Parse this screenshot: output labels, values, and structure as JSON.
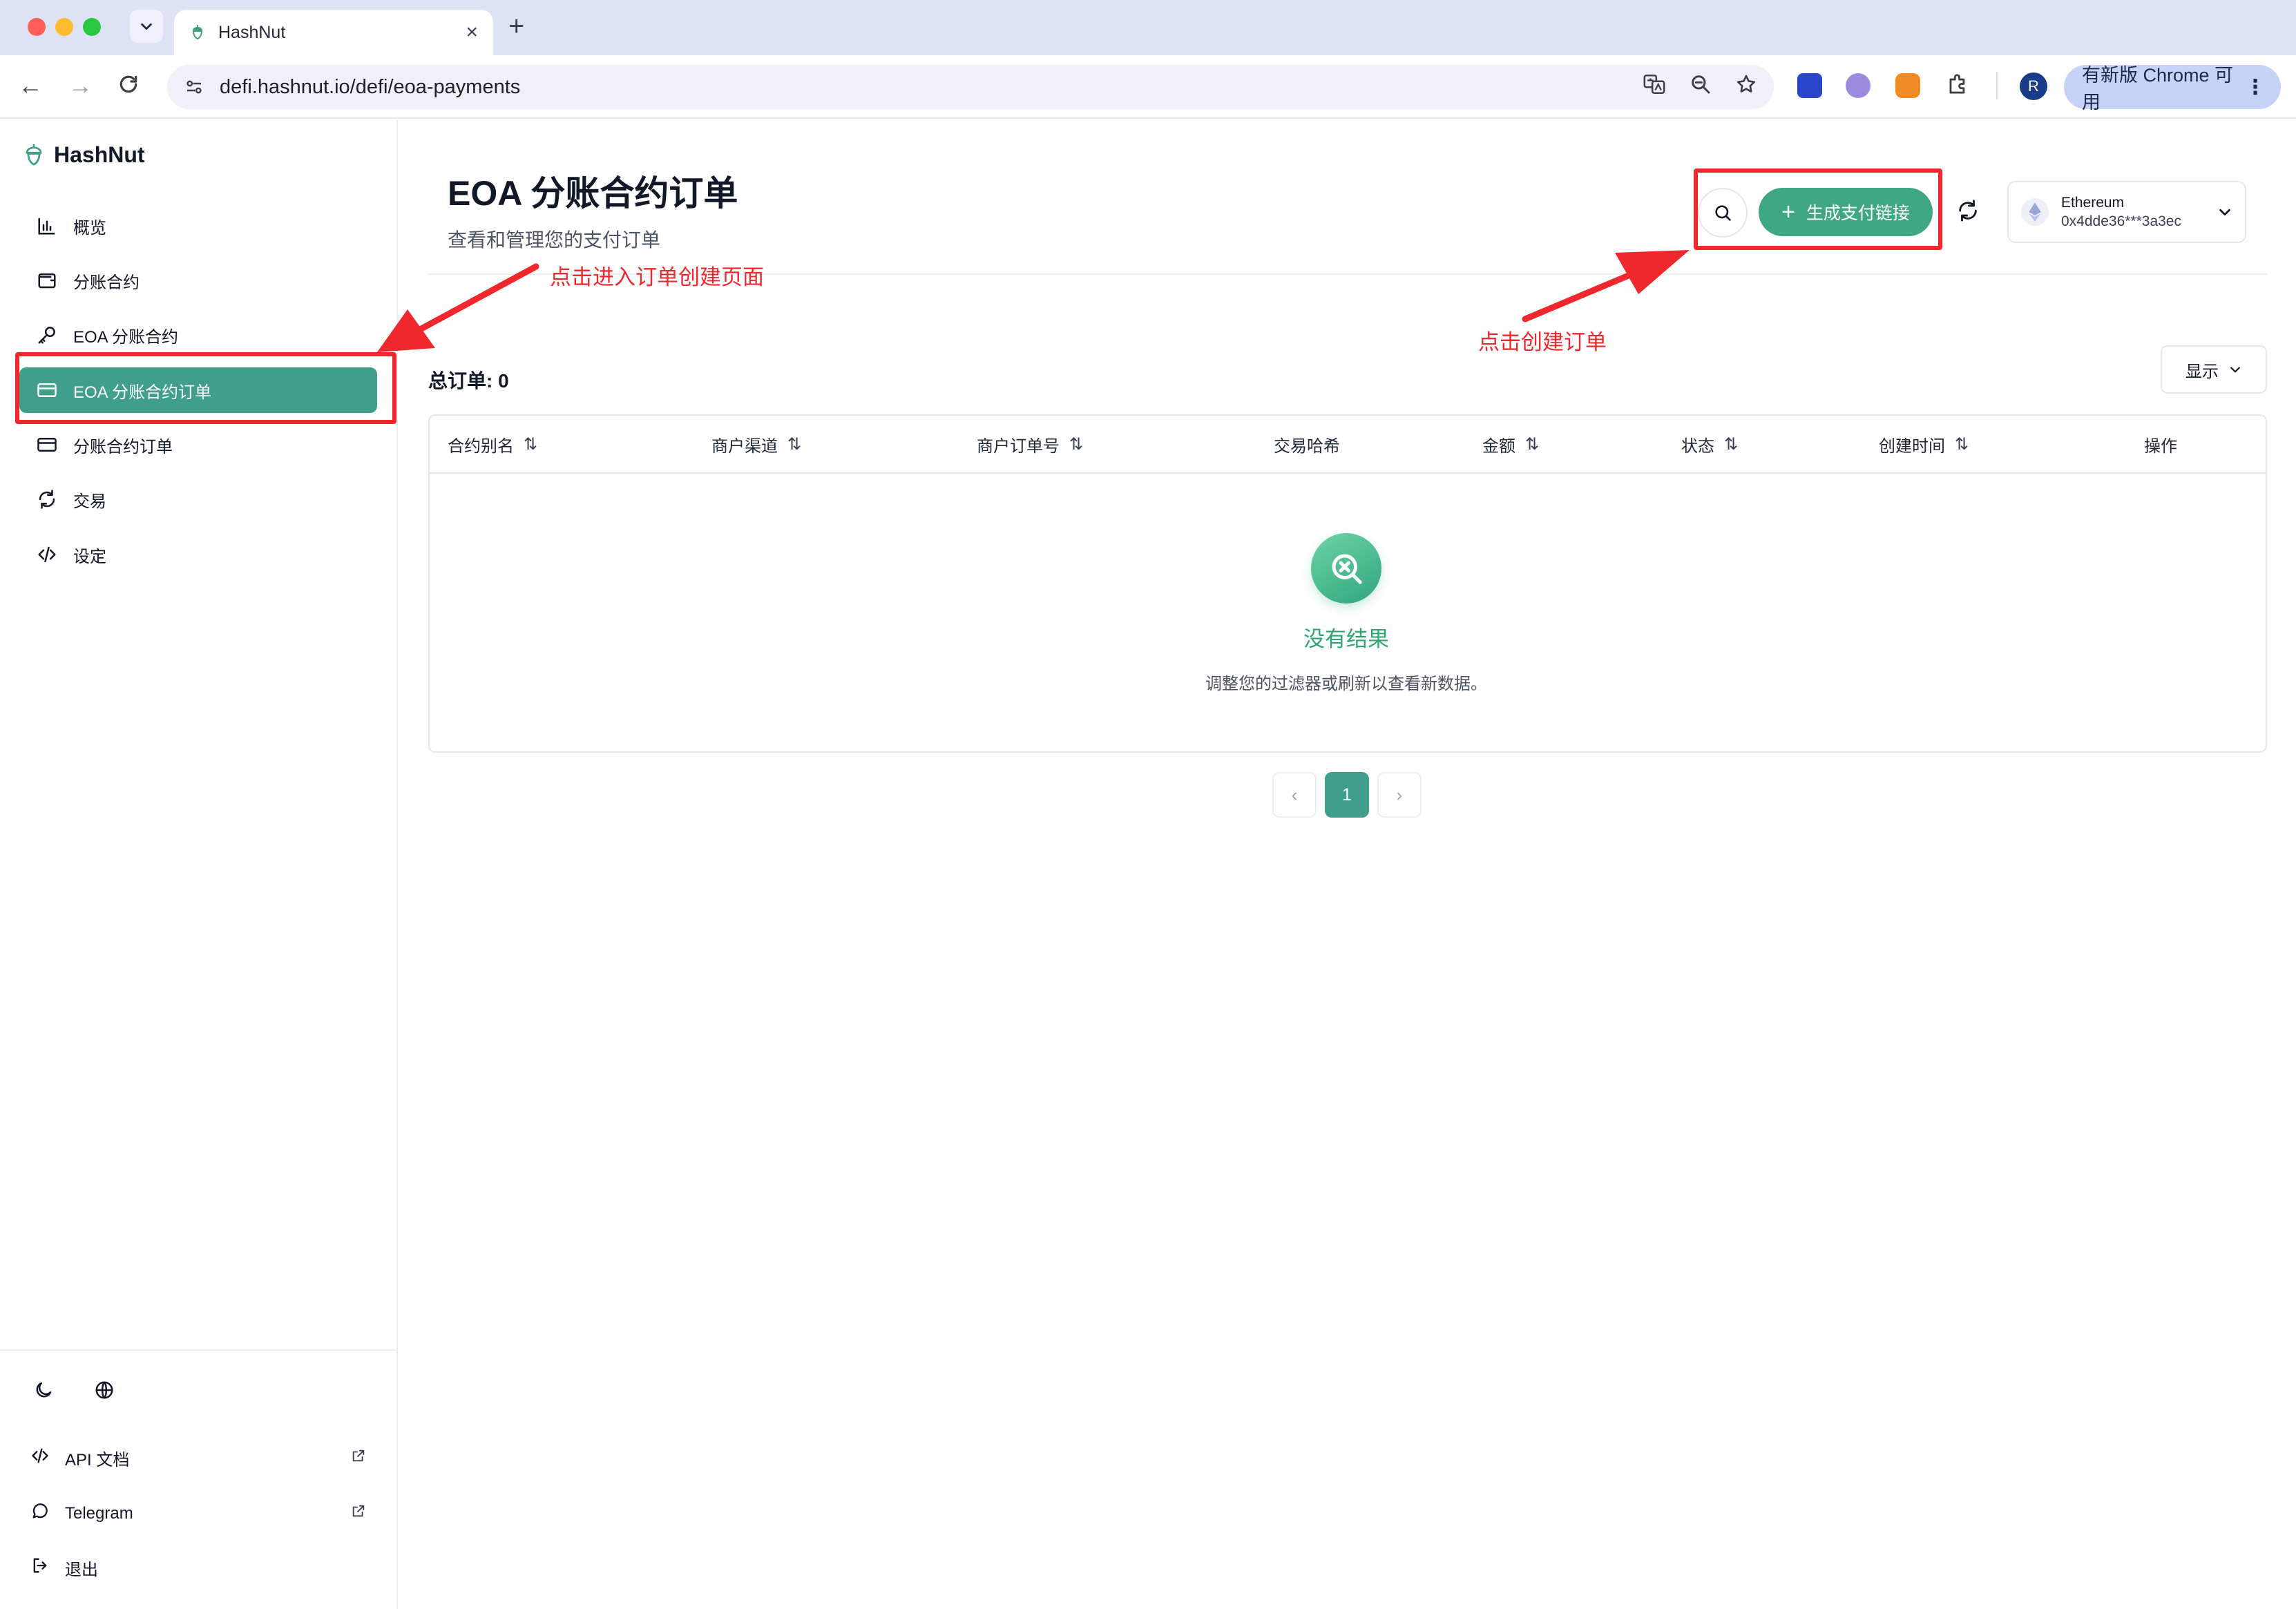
{
  "browser": {
    "tab_title": "HashNut",
    "url": "defi.hashnut.io/defi/eoa-payments",
    "update_label": "有新版 Chrome 可用",
    "profile_initial": "R"
  },
  "sidebar": {
    "brand": "HashNut",
    "items": [
      {
        "label": "概览",
        "icon": "bar-chart-icon"
      },
      {
        "label": "分账合约",
        "icon": "wallet-icon"
      },
      {
        "label": "EOA 分账合约",
        "icon": "key-icon"
      },
      {
        "label": "EOA 分账合约订单",
        "icon": "credit-card-icon"
      },
      {
        "label": "分账合约订单",
        "icon": "credit-card-icon"
      },
      {
        "label": "交易",
        "icon": "refresh-icon"
      },
      {
        "label": "设定",
        "icon": "code-icon"
      }
    ],
    "active_index": 3,
    "footer": {
      "api_docs": "API 文档",
      "telegram": "Telegram",
      "logout": "退出"
    }
  },
  "header": {
    "title": "EOA 分账合约订单",
    "subtitle": "查看和管理您的支付订单",
    "create_button": "生成支付链接",
    "wallet_network": "Ethereum",
    "wallet_address": "0x4dde36***3a3ec"
  },
  "table": {
    "total_label": "总订单: 0",
    "display_button": "显示",
    "columns": [
      "合约别名",
      "商户渠道",
      "商户订单号",
      "交易哈希",
      "金额",
      "状态",
      "创建时间",
      "操作"
    ],
    "rows": [],
    "empty_title": "没有结果",
    "empty_desc": "调整您的过滤器或刷新以查看新数据。"
  },
  "pagination": {
    "current_page": "1",
    "prev": "‹",
    "next": "›"
  },
  "annotations": {
    "sidebar_note": "点击进入订单创建页面",
    "create_note": "点击创建订单",
    "color": "#f0282d"
  },
  "colors": {
    "accent": "#3f9f8a",
    "primary_button": "#3fa883",
    "empty_title": "#2fa56e"
  }
}
